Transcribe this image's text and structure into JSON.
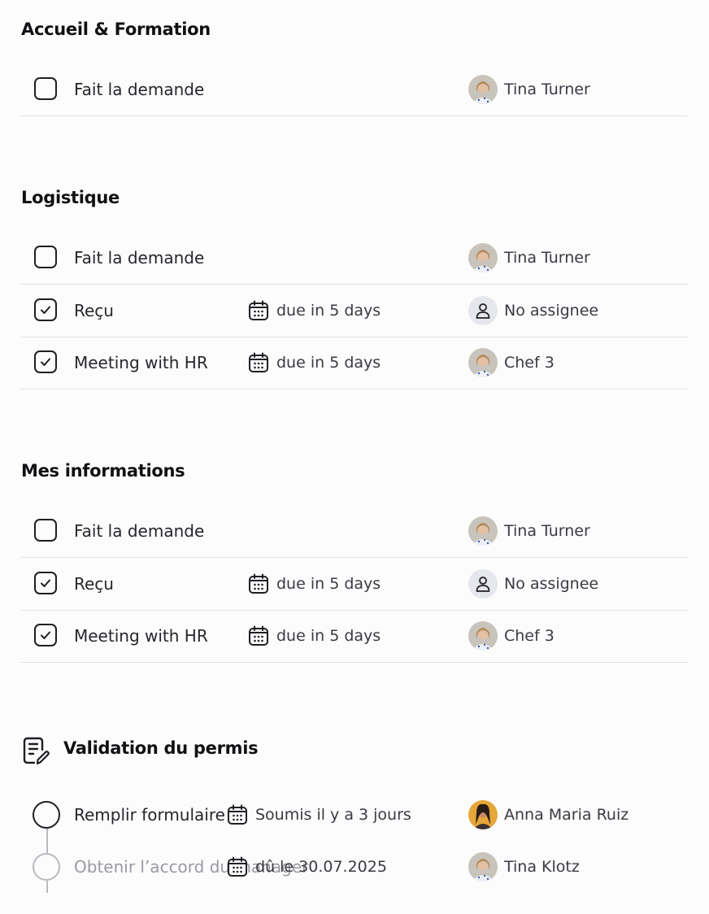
{
  "sections": [
    {
      "title": "Accueil & Formation",
      "rows": [
        {
          "checked": false,
          "label": "Fait la demande",
          "due": "",
          "assignee": "Tina Turner"
        }
      ]
    },
    {
      "title": "Logistique",
      "rows": [
        {
          "checked": false,
          "label": "Fait la demande",
          "due": "",
          "assignee": "Tina Turner"
        },
        {
          "checked": true,
          "label": "Reçu",
          "due": "due in 5 days",
          "assignee": "No assignee"
        },
        {
          "checked": true,
          "label": "Meeting with HR",
          "due": "due in 5 days",
          "assignee": "Chef 3"
        }
      ]
    },
    {
      "title": "Mes informations",
      "rows": [
        {
          "checked": false,
          "label": "Fait la demande",
          "due": "",
          "assignee": "Tina Turner"
        },
        {
          "checked": true,
          "label": "Reçu",
          "due": "due in 5 days",
          "assignee": "No assignee"
        },
        {
          "checked": true,
          "label": "Meeting with HR",
          "due": "due in 5 days",
          "assignee": "Chef 3"
        }
      ]
    }
  ],
  "workflow": {
    "title": "Validation du permis",
    "icon": "form-edit-icon",
    "steps": [
      {
        "label": "Remplir formulaire",
        "date": "Soumis il y a 3 jours",
        "assignee": "Anna Maria Ruiz"
      },
      {
        "label": "Obtenir l’accord du manager",
        "date": "dû le 30.07.2025",
        "assignee": "Tina Klotz"
      }
    ]
  }
}
